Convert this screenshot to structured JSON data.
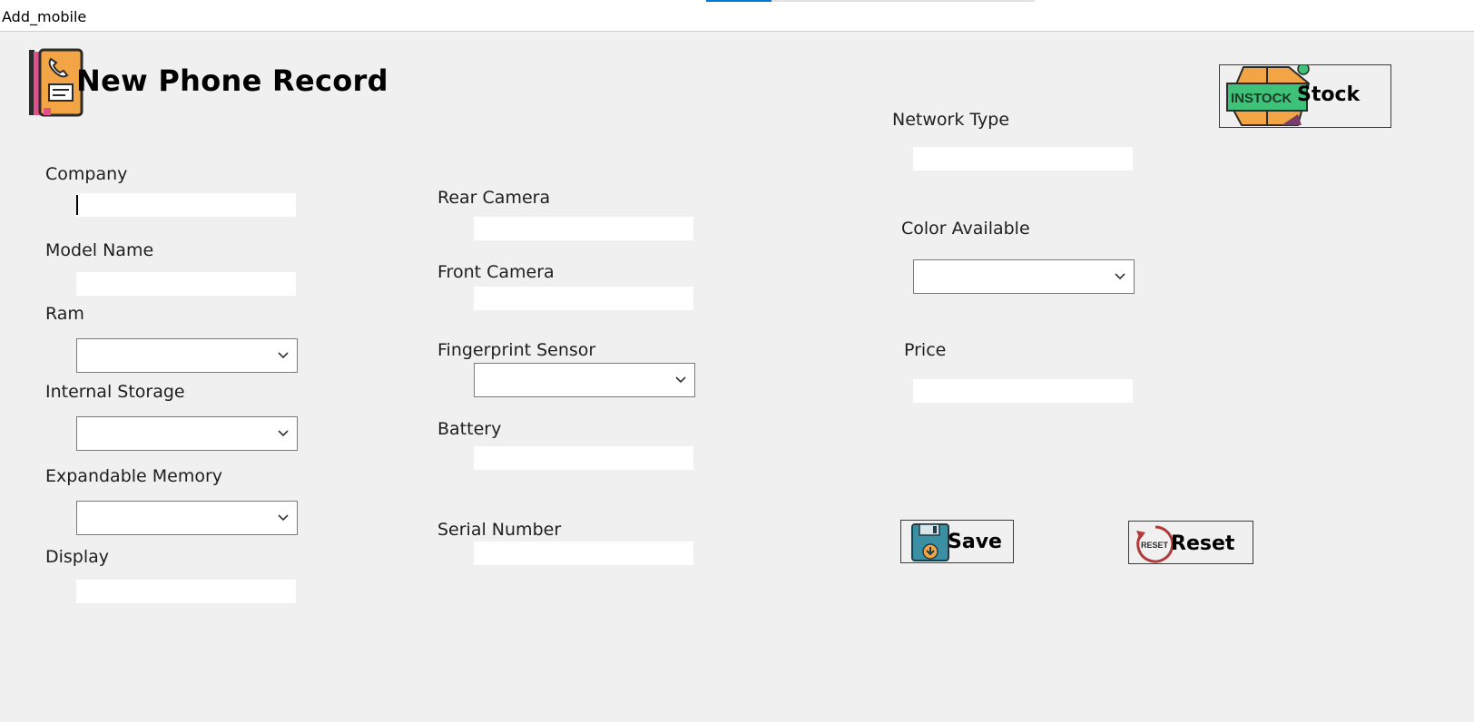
{
  "window": {
    "title": "Add_mobile"
  },
  "header": {
    "title": "New Phone Record",
    "icon": "phone-record-icon"
  },
  "fields": {
    "company": {
      "label": "Company",
      "value": ""
    },
    "model_name": {
      "label": "Model Name",
      "value": ""
    },
    "ram": {
      "label": "Ram",
      "value": ""
    },
    "internal_storage": {
      "label": "Internal Storage",
      "value": ""
    },
    "expandable_memory": {
      "label": "Expandable Memory",
      "value": ""
    },
    "display": {
      "label": "Display",
      "value": ""
    },
    "rear_camera": {
      "label": "Rear Camera",
      "value": ""
    },
    "front_camera": {
      "label": "Front Camera",
      "value": ""
    },
    "fingerprint_sensor": {
      "label": "Fingerprint Sensor",
      "value": ""
    },
    "battery": {
      "label": "Battery",
      "value": ""
    },
    "serial_number": {
      "label": "Serial Number",
      "value": ""
    },
    "network_type": {
      "label": "Network Type",
      "value": ""
    },
    "color_available": {
      "label": "Color Available",
      "value": ""
    },
    "price": {
      "label": "Price",
      "value": ""
    }
  },
  "buttons": {
    "stock": {
      "label": "Stock",
      "icon_text": "INSTOCK",
      "icon": "in-stock-icon"
    },
    "save": {
      "label": "Save",
      "icon": "floppy-disk-icon"
    },
    "reset": {
      "label": "Reset",
      "icon_text": "RESET",
      "icon": "reset-icon"
    }
  },
  "colors": {
    "background": "#f0f0f0",
    "accent": "#0078d7",
    "stock_green": "#3ec27a",
    "stock_orange": "#f3a445",
    "save_teal": "#3b8fa3",
    "reset_red": "#b23a3a"
  }
}
